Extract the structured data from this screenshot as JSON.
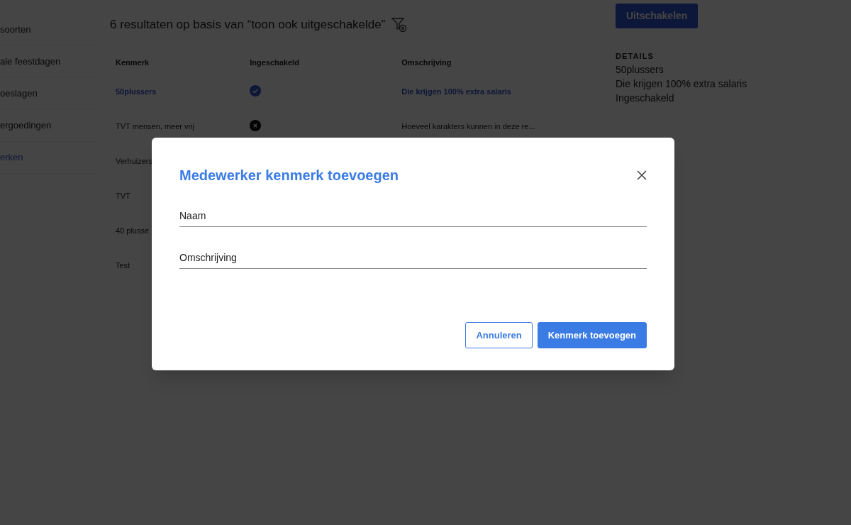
{
  "sidebar": {
    "items": [
      {
        "label": "soorten",
        "selected": false
      },
      {
        "label": "ale feestdagen",
        "selected": false
      },
      {
        "label": "oeslagen",
        "selected": false
      },
      {
        "label": "ergoedingen",
        "selected": false
      },
      {
        "label": "erken",
        "selected": true
      }
    ]
  },
  "results_heading": "6 resultaten op basis van “toon ook uitgeschakelde”",
  "table": {
    "columns": [
      "Kenmerk",
      "Ingeschakeld",
      "Omschrijving"
    ],
    "rows": [
      {
        "name": "50plussers",
        "enabled": true,
        "description": "Die krijgen 100% extra salaris",
        "selected": true
      },
      {
        "name": "TVT mensen, meer vrij",
        "enabled": false,
        "description": "Hoeveel karakters kunnen in deze re...",
        "selected": false
      },
      {
        "name": "Verhuizers",
        "selected": false
      },
      {
        "name": "TVT",
        "selected": false
      },
      {
        "name": "40 plusse",
        "selected": false
      },
      {
        "name": "Test",
        "selected": false
      }
    ]
  },
  "disable_button": "Uitschakelen",
  "details": {
    "heading": "DETAILS",
    "lines": [
      "50plussers",
      "Die krijgen 100% extra salaris",
      "Ingeschakeld"
    ]
  },
  "dialog": {
    "title": "Medewerker kenmerk toevoegen",
    "fields": [
      {
        "placeholder": "Naam"
      },
      {
        "placeholder": "Omschrijving"
      }
    ],
    "buttons": [
      {
        "label": "Annuleren",
        "kind": "secondary"
      },
      {
        "label": "Kenmerk toevoegen",
        "kind": "primary"
      }
    ]
  }
}
